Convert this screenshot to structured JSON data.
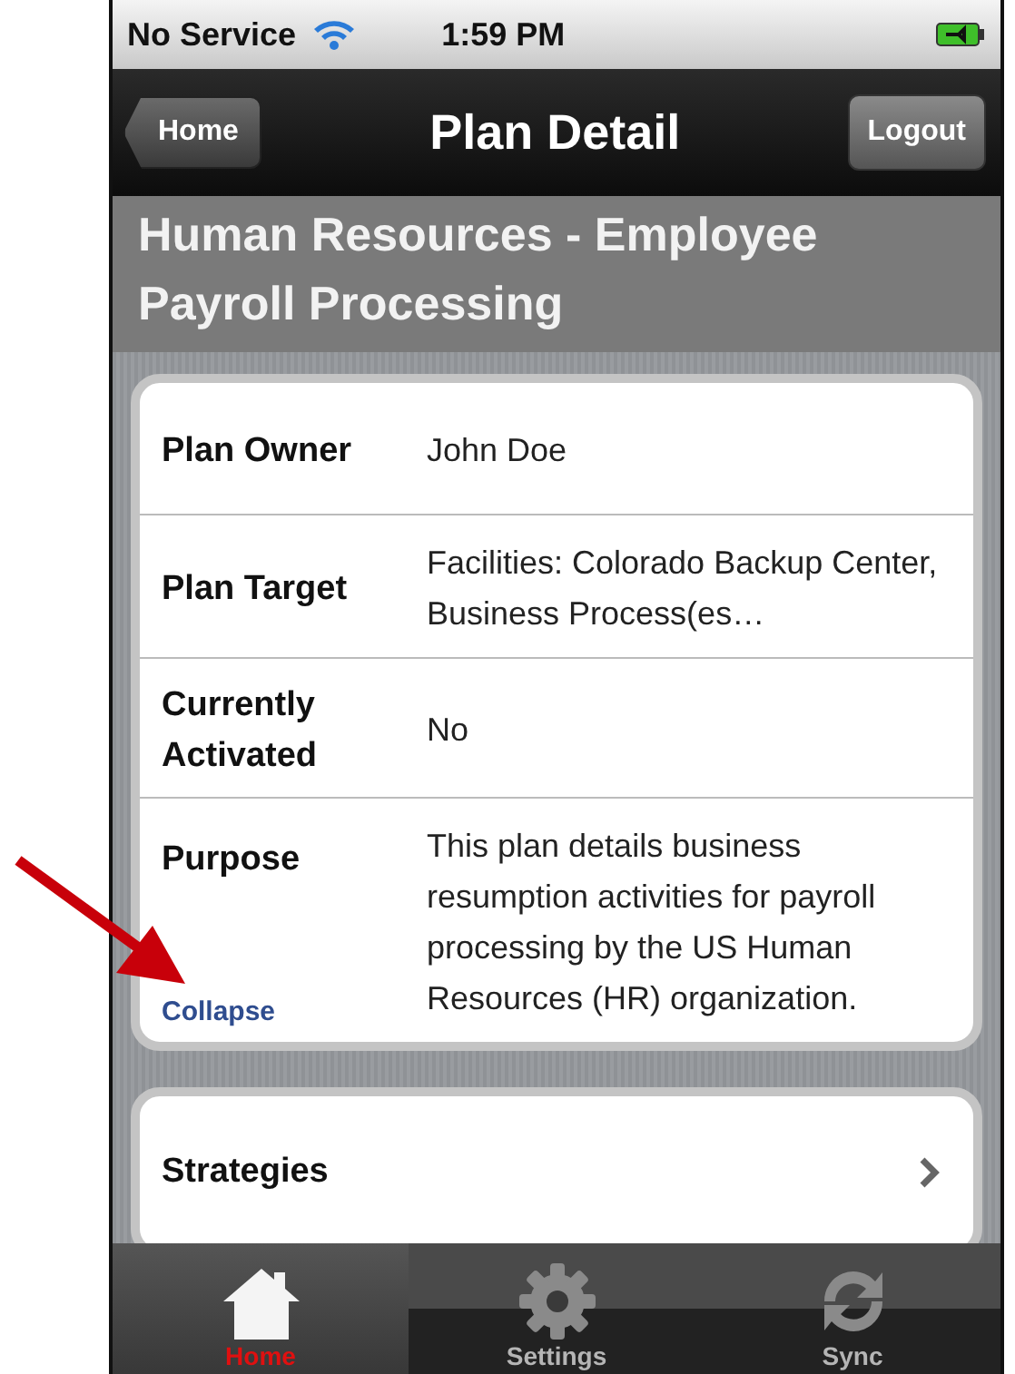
{
  "status_bar": {
    "carrier": "No Service",
    "time": "1:59 PM"
  },
  "nav_bar": {
    "back": "Home",
    "title": "Plan Detail",
    "action": "Logout"
  },
  "plan_title": "Human Resources - Employee Payroll Processing",
  "details": [
    {
      "label": "Plan Owner",
      "value": "John Doe"
    },
    {
      "label": "Plan Target",
      "value": "Facilities: Colorado Backup Center, Business Process(es…"
    },
    {
      "label": "Currently Activated",
      "value": "No"
    },
    {
      "label": "Purpose",
      "value": "This plan details business resumption activities for payroll processing by the US Human Resources (HR) organization.",
      "link": "Collapse"
    }
  ],
  "sections": [
    {
      "label": "Strategies"
    }
  ],
  "tab_bar": [
    {
      "label": "Home",
      "kind": "home",
      "selected": true
    },
    {
      "label": "Settings",
      "kind": "gear",
      "selected": false
    },
    {
      "label": "Sync",
      "kind": "sync",
      "selected": false
    }
  ]
}
